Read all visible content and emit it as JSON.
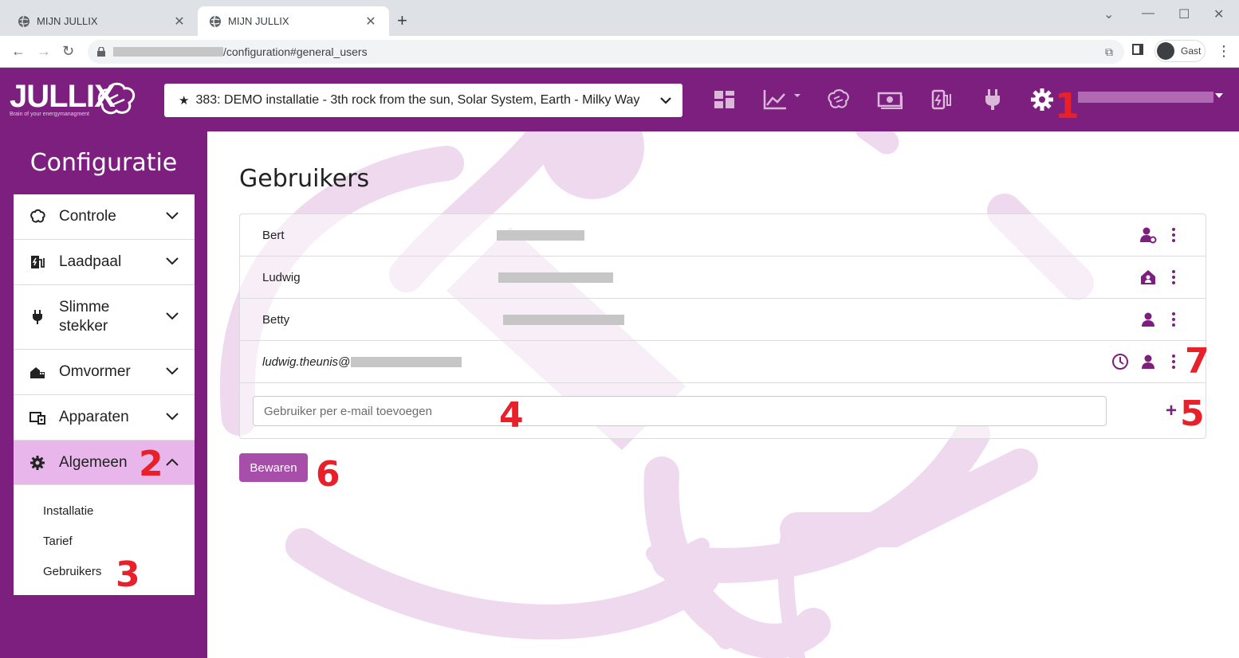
{
  "browser": {
    "tabs": [
      {
        "label": "MIJN JULLIX"
      },
      {
        "label": "MIJN JULLIX"
      }
    ],
    "url_suffix": "/configuration#general_users",
    "profile_label": "Gast"
  },
  "header": {
    "logo_text": "JULLIX",
    "logo_tagline": "Brain of your energymanagment",
    "installation": "383: DEMO installatie - 3th rock from the sun, Solar System, Earth - Milky Way"
  },
  "sidebar": {
    "title": "Configuratie",
    "items": [
      {
        "label": "Controle",
        "icon": "brain-icon"
      },
      {
        "label": "Laadpaal",
        "icon": "charger-icon"
      },
      {
        "label": "Slimme stekker",
        "icon": "plug-icon"
      },
      {
        "label": "Omvormer",
        "icon": "solar-house-icon"
      },
      {
        "label": "Apparaten",
        "icon": "devices-icon"
      },
      {
        "label": "Algemeen",
        "icon": "gear-icon"
      }
    ],
    "subitems": [
      "Installatie",
      "Tarief",
      "Gebruikers"
    ]
  },
  "main": {
    "title": "Gebruikers",
    "users": [
      {
        "name": "Bert",
        "role_icon": "user-cog-icon"
      },
      {
        "name": "Ludwig",
        "role_icon": "house-user-icon"
      },
      {
        "name": "Betty",
        "role_icon": "user-icon"
      },
      {
        "name": "ludwig.theunis@",
        "role_icon": "user-icon",
        "pending_icon": "clock-icon"
      }
    ],
    "add_placeholder": "Gebruiker per e-mail toevoegen",
    "add_button": "+",
    "save_label": "Bewaren"
  },
  "annotations": [
    "1",
    "2",
    "3",
    "4",
    "5",
    "6",
    "7"
  ],
  "colors": {
    "brand": "#7d1f7f",
    "active_menu": "#e8b6ea",
    "save_button": "#a64ea9",
    "annotation": "#e8202a"
  }
}
